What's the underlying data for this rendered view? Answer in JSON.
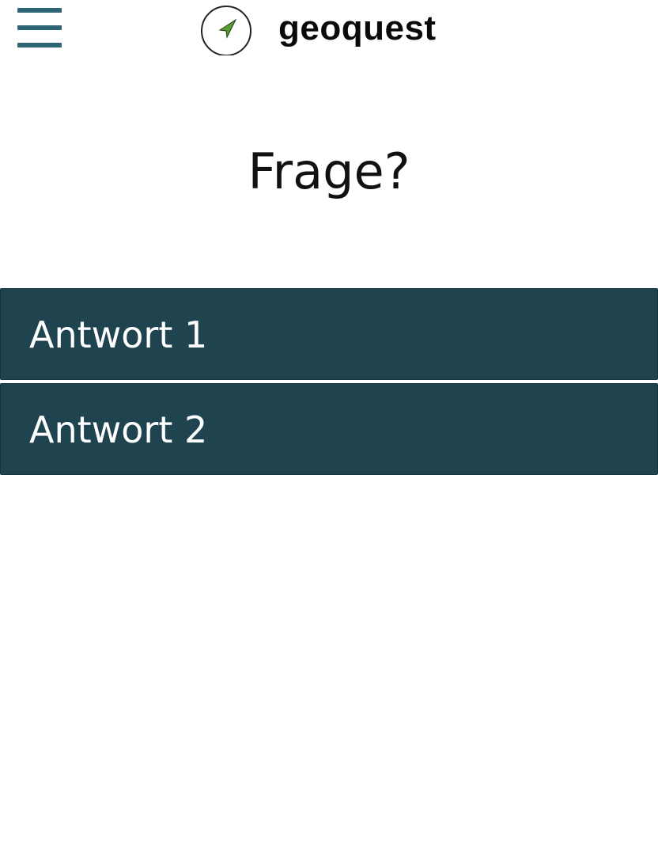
{
  "header": {
    "app_name": "geoquest",
    "menu_icon": "hamburger-menu-icon",
    "logo_icon": "compass-arrow-icon"
  },
  "question": {
    "text": "Frage?"
  },
  "answers": [
    {
      "label": "Antwort 1"
    },
    {
      "label": "Antwort 2"
    }
  ],
  "colors": {
    "answer_background": "#1f4450",
    "menu_icon": "#2f6675",
    "logo_arrow": "#5a9e33",
    "text_dark": "#111111"
  }
}
